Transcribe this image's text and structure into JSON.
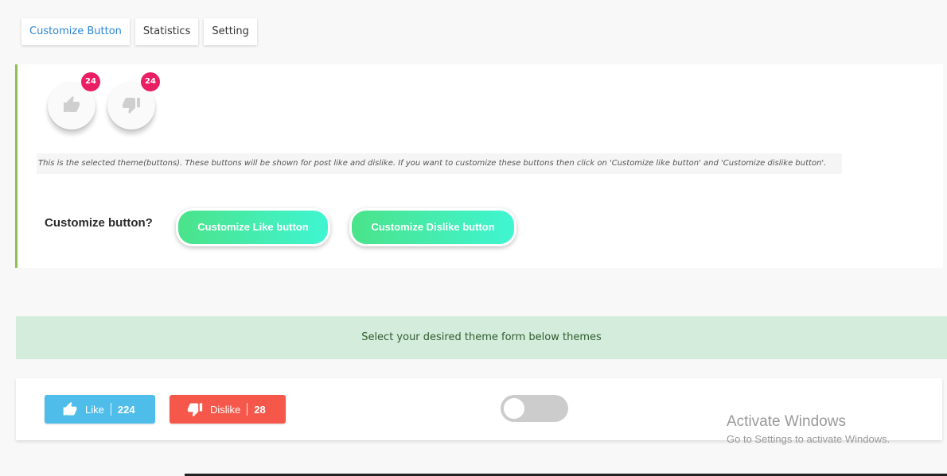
{
  "tabs": [
    {
      "label": "Customize Button",
      "active": true
    },
    {
      "label": "Statistics",
      "active": false
    },
    {
      "label": "Setting",
      "active": false
    }
  ],
  "selected_theme": {
    "like_count": "24",
    "dislike_count": "24",
    "like_icon": "thumbs-up-icon",
    "dislike_icon": "thumbs-down-icon",
    "note": "This is the selected theme(buttons). These buttons will be shown for post like and dislike. If you want to customize these buttons then click on 'Customize like button' and 'Customize dislike button'.",
    "customize_label": "Customize button?",
    "customize_like_label": "Customize Like button",
    "customize_dislike_label": "Customize Dislike button"
  },
  "banner": {
    "text": "Select your desired theme form below themes"
  },
  "theme_option": {
    "like_label": "Like",
    "like_count": "224",
    "dislike_label": "Dislike",
    "dislike_count": "28",
    "toggle_on": false
  },
  "watermark": {
    "title": "Activate Windows",
    "subtitle": "Go to Settings to activate Windows."
  },
  "colors": {
    "accent_blue": "#2d87d6",
    "panel_border": "#8cc152",
    "badge": "#e91e63",
    "gradient_start": "#4be38a",
    "gradient_end": "#3ff5d2",
    "banner_bg": "#d4ecdb",
    "like_btn": "#4fbdea",
    "dislike_btn": "#f5574a",
    "toggle_off": "#cccccc"
  }
}
